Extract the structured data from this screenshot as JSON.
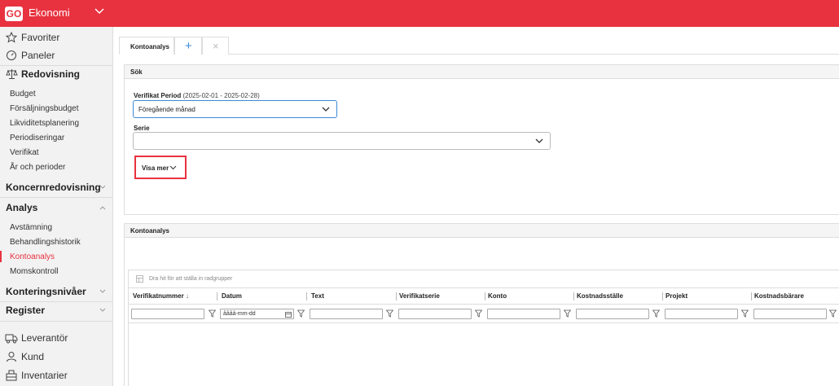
{
  "app": {
    "logo_text": "GO",
    "title": "Ekonomi",
    "brand_color": "#e8323f"
  },
  "sidebar": {
    "top_items": [
      {
        "label": "Favoriter",
        "icon": "star-icon"
      },
      {
        "label": "Paneler",
        "icon": "gauge-icon"
      }
    ],
    "redovisning": {
      "label": "Redovisning",
      "icon": "scale-icon",
      "items": [
        "Budget",
        "Försäljningsbudget",
        "Likviditetsplanering",
        "Periodiseringar",
        "Verifikat",
        "År och perioder"
      ]
    },
    "koncernredovisning": {
      "label": "Koncernredovisning"
    },
    "analys": {
      "label": "Analys",
      "items": [
        "Avstämning",
        "Behandlingshistorik",
        "Kontoanalys",
        "Momskontroll"
      ],
      "active": "Kontoanalys"
    },
    "konteringsnivaer": {
      "label": "Konteringsnivåer"
    },
    "register": {
      "label": "Register"
    },
    "bottom_items": [
      {
        "label": "Leverantör",
        "icon": "truck-icon"
      },
      {
        "label": "Kund",
        "icon": "person-icon"
      },
      {
        "label": "Inventarier",
        "icon": "inventory-icon"
      }
    ]
  },
  "tabs": {
    "active_label": "Kontoanalys",
    "add_symbol": "+",
    "close_symbol": "×"
  },
  "search_panel": {
    "title": "Sök",
    "period_label": "Verifikat Period",
    "period_range": "(2025-02-01 - 2025-02-28)",
    "period_value": "Föregående månad",
    "serie_label": "Serie",
    "serie_value": "",
    "show_more": "Visa mer"
  },
  "result_panel": {
    "title": "Kontoanalys",
    "group_hint": "Dra hit för att ställa in radgrupper",
    "columns": [
      "Verifikatnummer",
      "Datum",
      "Text",
      "Verifikatserie",
      "Konto",
      "Kostnadsställe",
      "Projekt",
      "Kostnadsbärare"
    ],
    "sort_arrow": "↓",
    "date_placeholder": "åååå-mm-dd",
    "filter_values": [
      "",
      "",
      "",
      "",
      "",
      "",
      "",
      ""
    ]
  }
}
